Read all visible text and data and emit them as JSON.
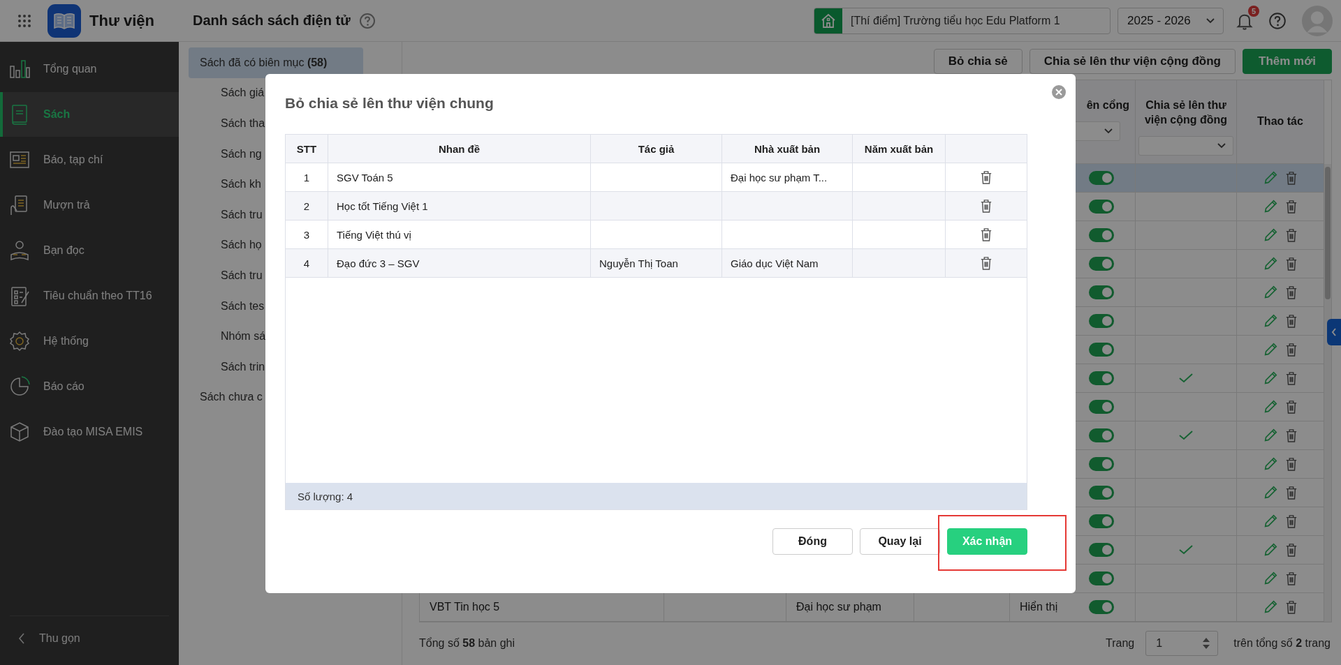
{
  "app": {
    "title": "Thư viện"
  },
  "header": {
    "page_title": "Danh sách sách điện tử",
    "school": "[Thí điểm] Trường tiểu học Edu Platform 1",
    "school_year": "2025 - 2026",
    "notification_count": "5"
  },
  "sidebar": {
    "items": [
      {
        "label": "Tổng quan",
        "kind": "overview",
        "selected": false
      },
      {
        "label": "Sách",
        "kind": "book",
        "selected": true
      },
      {
        "label": "Báo, tạp chí",
        "kind": "newspaper",
        "selected": false
      },
      {
        "label": "Mượn trả",
        "kind": "borrow",
        "selected": false
      },
      {
        "label": "Bạn đọc",
        "kind": "reader",
        "selected": false
      },
      {
        "label": "Tiêu chuẩn theo TT16",
        "kind": "checklist",
        "selected": false
      },
      {
        "label": "Hệ thống",
        "kind": "settings",
        "selected": false
      },
      {
        "label": "Báo cáo",
        "kind": "report",
        "selected": false
      },
      {
        "label": "Đào tạo MISA EMIS",
        "kind": "training",
        "selected": false
      }
    ],
    "collapse_label": "Thu gọn"
  },
  "categories": [
    {
      "label": "Sách đã có biên mục **(58)**",
      "selected": true,
      "children": [
        {
          "label": "Sách giá",
          "selected": false
        },
        {
          "label": "Sách tha",
          "selected": false
        },
        {
          "label": "Sách ng",
          "selected": false
        },
        {
          "label": "Sách kh",
          "selected": false
        },
        {
          "label": "Sách tru",
          "selected": false
        },
        {
          "label": "Sách họ",
          "selected": false
        },
        {
          "label": "Sách tru",
          "selected": false
        },
        {
          "label": "Sách tes",
          "selected": false
        },
        {
          "label": "Nhóm sá",
          "selected": false
        },
        {
          "label": "Sách trin",
          "selected": false
        }
      ]
    },
    {
      "label": "Sách chưa c",
      "selected": false
    }
  ],
  "toolbar": {
    "buttons": [
      {
        "label": "Bỏ chia sẻ",
        "kind": "outline"
      },
      {
        "label": "Chia sẻ lên thư viện cộng đồng",
        "kind": "outline"
      },
      {
        "label": "Thêm mới",
        "kind": "primary"
      }
    ]
  },
  "table": {
    "columns": [
      "ên cổng",
      "Chia sẻ lên thư viện cộng đồng",
      "Thao tác"
    ],
    "rows": [
      {
        "selected": true,
        "published": true,
        "shared": false
      },
      {
        "selected": false,
        "published": true,
        "shared": false
      },
      {
        "selected": false,
        "published": true,
        "shared": false
      },
      {
        "selected": false,
        "published": true,
        "shared": false
      },
      {
        "selected": false,
        "published": true,
        "shared": false
      },
      {
        "selected": false,
        "published": true,
        "shared": false
      },
      {
        "selected": false,
        "published": true,
        "shared": false
      },
      {
        "selected": false,
        "published": true,
        "shared": true
      },
      {
        "selected": false,
        "published": true,
        "shared": false
      },
      {
        "selected": false,
        "published": true,
        "shared": true
      },
      {
        "selected": false,
        "published": true,
        "shared": false
      },
      {
        "selected": false,
        "published": true,
        "shared": false
      },
      {
        "selected": false,
        "published": true,
        "shared": false
      },
      {
        "selected": false,
        "published": true,
        "shared": true
      },
      {
        "selected": false,
        "published": true,
        "shared": false
      },
      {
        "selected": false,
        "published": true,
        "shared": false,
        "title": "VBT Tin học 5",
        "publisher": "Đại học sư phạm",
        "display": "Hiển thị"
      }
    ]
  },
  "footer": {
    "total": "Tổng số **58** bản ghi",
    "page_label": "Trang",
    "page": "1",
    "page_total": "trên tổng số **2** trang"
  },
  "dialog": {
    "title": "Bỏ chia sẻ lên thư viện chung",
    "columns": [
      "STT",
      "Nhan đề",
      "Tác giả",
      "Nhà xuất bản",
      "Năm xuất bản"
    ],
    "rows": [
      {
        "index": "1",
        "title": "SGV Toán 5",
        "publisher": "Đại học sư phạm T..."
      },
      {
        "index": "2",
        "title": "Học tốt Tiếng Việt 1"
      },
      {
        "index": "3",
        "title": "Tiếng Việt thú vị"
      },
      {
        "index": "4",
        "title": "Đạo đức 3 – SGV",
        "author": "Nguyễn Thị Toan",
        "publisher": "Giáo dục Việt Nam"
      }
    ],
    "count_label": "Số lượng: 4",
    "buttons": [
      {
        "label": "Đóng",
        "kind": "outline",
        "highlighted": false
      },
      {
        "label": "Quay lại",
        "kind": "outline",
        "highlighted": false
      },
      {
        "label": "Xác nhận",
        "kind": "primary",
        "highlighted": true
      }
    ]
  }
}
